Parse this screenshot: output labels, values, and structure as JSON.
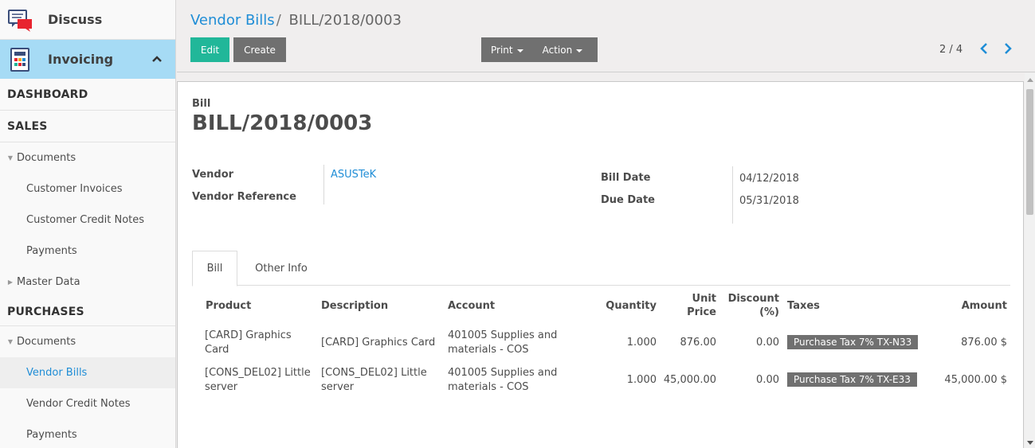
{
  "sidebar": {
    "discuss_label": "Discuss",
    "invoicing_label": "Invoicing",
    "dashboard": "DASHBOARD",
    "sales": "SALES",
    "sales_documents": "Documents",
    "customer_invoices": "Customer Invoices",
    "customer_credit_notes": "Customer Credit Notes",
    "sales_payments": "Payments",
    "master_data": "Master Data",
    "purchases": "PURCHASES",
    "purchases_documents": "Documents",
    "vendor_bills": "Vendor Bills",
    "vendor_credit_notes": "Vendor Credit Notes",
    "purchases_payments": "Payments"
  },
  "breadcrumb": {
    "parent": "Vendor Bills",
    "separator": "/",
    "current": "BILL/2018/0003"
  },
  "toolbar": {
    "edit": "Edit",
    "create": "Create",
    "print": "Print",
    "action": "Action"
  },
  "pager": {
    "text": "2 / 4"
  },
  "form": {
    "doc_type": "Bill",
    "number": "BILL/2018/0003",
    "vendor_label": "Vendor",
    "vendor_value": "ASUSTeK",
    "vendor_ref_label": "Vendor Reference",
    "bill_date_label": "Bill Date",
    "bill_date_value": "04/12/2018",
    "due_date_label": "Due Date",
    "due_date_value": "05/31/2018"
  },
  "tabs": [
    "Bill",
    "Other Info"
  ],
  "lines": {
    "headers": {
      "product": "Product",
      "description": "Description",
      "account": "Account",
      "quantity": "Quantity",
      "unit_price_1": "Unit",
      "unit_price_2": "Price",
      "discount_1": "Discount",
      "discount_2": "(%)",
      "taxes": "Taxes",
      "amount": "Amount"
    },
    "rows": [
      {
        "product": "[CARD] Graphics Card",
        "description": "[CARD] Graphics Card",
        "account": "401005 Supplies and materials - COS",
        "quantity": "1.000",
        "unit_price": "876.00",
        "discount": "0.00",
        "tax": "Purchase Tax 7% TX-N33",
        "amount": "876.00 $"
      },
      {
        "product": "[CONS_DEL02] Little server",
        "description": "[CONS_DEL02] Little server",
        "account": "401005 Supplies and materials - COS",
        "quantity": "1.000",
        "unit_price": "45,000.00",
        "discount": "0.00",
        "tax": "Purchase Tax 7% TX-E33",
        "amount": "45,000.00 $"
      }
    ]
  },
  "colors": {
    "accent_link": "#1f8dd6",
    "edit_button": "#21b799",
    "secondary_button": "#707070",
    "active_app": "#a6dbf5"
  }
}
